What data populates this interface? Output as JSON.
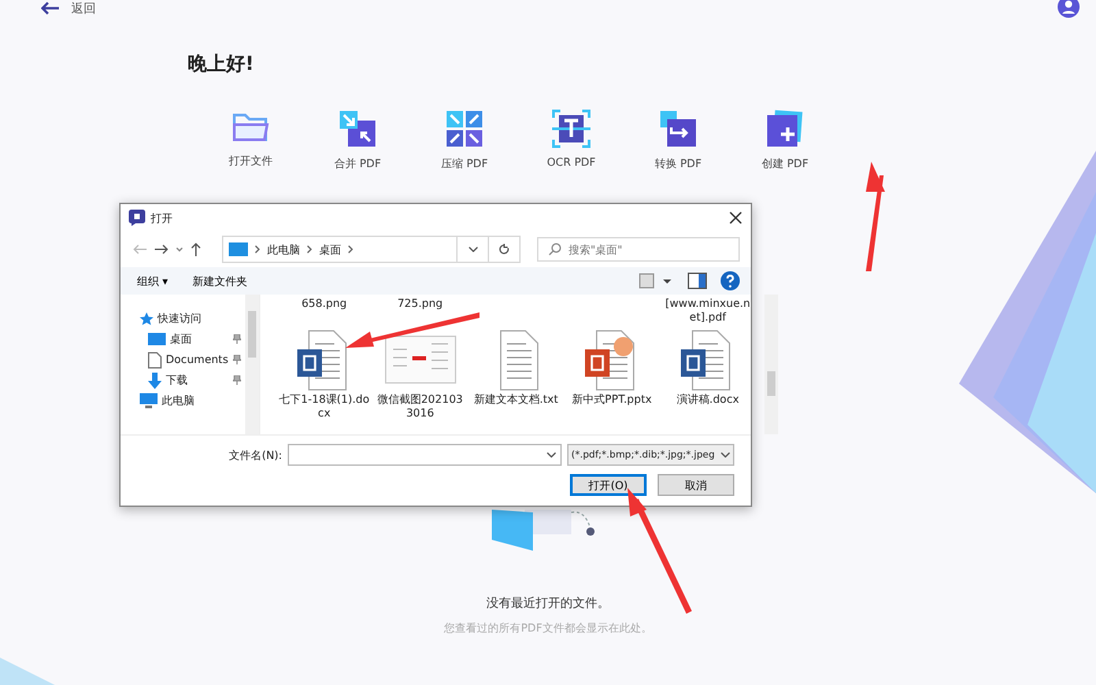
{
  "app": {
    "back": "返回",
    "greeting": "晚上好!",
    "tools": [
      {
        "kind": "folder",
        "label": "打开文件"
      },
      {
        "kind": "merge",
        "label": "合并 PDF"
      },
      {
        "kind": "compress",
        "label": "压缩 PDF"
      },
      {
        "kind": "ocr",
        "label": "OCR PDF"
      },
      {
        "kind": "convert",
        "label": "转换 PDF"
      },
      {
        "kind": "create",
        "label": "创建 PDF"
      }
    ],
    "empty_title": "没有最近打开的文件。",
    "empty_hint": "您查看过的所有PDF文件都会显示在此处。"
  },
  "dialog": {
    "title": "打开",
    "path": [
      "此电脑",
      "桌面"
    ],
    "search": {
      "placeholder": "搜索\"桌面\""
    },
    "toolbar": [
      "组织 ▾",
      "新建文件夹"
    ],
    "sidebar": [
      {
        "kind": "star",
        "label": "快速访问"
      },
      {
        "kind": "desktop",
        "label": "桌面",
        "pinned": true
      },
      {
        "kind": "doc",
        "label": "Documents",
        "pinned": true
      },
      {
        "kind": "download",
        "label": "下载",
        "pinned": true
      },
      {
        "kind": "pc",
        "label": "此电脑",
        "pinned": false
      }
    ],
    "top_row": [
      "658.png",
      "725.png",
      "[www.minxue.net].pdf"
    ],
    "files": [
      {
        "kind": "word",
        "name": "七下1-18课(1).docx"
      },
      {
        "kind": "image",
        "name": "微信截图2021033016"
      },
      {
        "kind": "text",
        "name": "新建文本文档.txt"
      },
      {
        "kind": "ppt",
        "name": "新中式PPT.pptx"
      },
      {
        "kind": "word",
        "name": "演讲稿.docx"
      }
    ],
    "filename_label": "文件名(N):",
    "filetype": "(*.pdf;*.bmp;*.dib;*.jpg;*.jpeg",
    "open": "打开(O)",
    "cancel": "取消"
  }
}
